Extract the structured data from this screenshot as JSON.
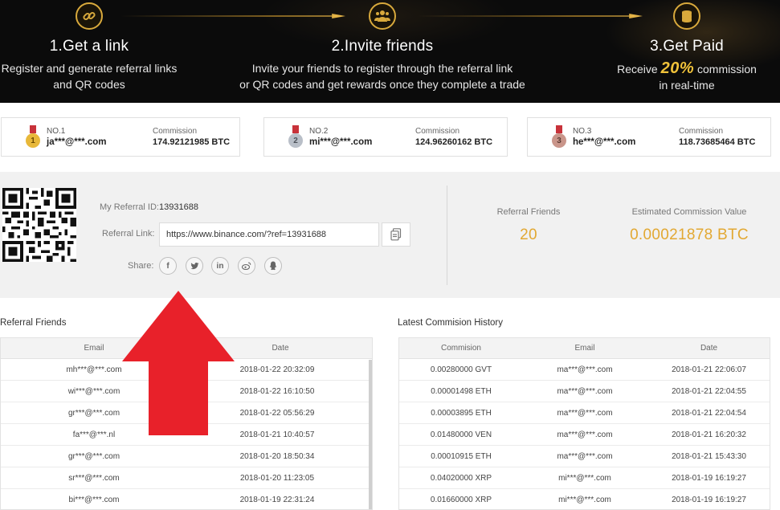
{
  "banner": {
    "steps": [
      {
        "title": "1.Get a link",
        "desc_line1": "Register and generate referral links",
        "desc_line2": "and QR codes"
      },
      {
        "title": "2.Invite friends",
        "desc_line1": "Invite your friends to register through the referral link",
        "desc_line2": "or QR codes and get rewards once they complete a trade"
      },
      {
        "title": "3.Get Paid",
        "desc_pre": "Receive",
        "desc_pct": "20%",
        "desc_post": "commission",
        "desc_line2": "in real-time"
      }
    ]
  },
  "top_referrers": [
    {
      "rank": "NO.1",
      "num": "1",
      "email": "ja***@***.com",
      "commission_label": "Commission",
      "commission": "174.92121985 BTC",
      "medal_color": "#e8b83a"
    },
    {
      "rank": "NO.2",
      "num": "2",
      "email": "mi***@***.com",
      "commission_label": "Commission",
      "commission": "124.96260162 BTC",
      "medal_color": "#b9bfc8"
    },
    {
      "rank": "NO.3",
      "num": "3",
      "email": "he***@***.com",
      "commission_label": "Commission",
      "commission": "118.73685464 BTC",
      "medal_color": "#c9958a"
    }
  ],
  "referral": {
    "id_label": "My Referral ID:",
    "id_value": "13931688",
    "link_label": "Referral Link:",
    "link_value": "https://www.binance.com/?ref=13931688",
    "share_label": "Share:",
    "share_icons": [
      "facebook-icon",
      "twitter-icon",
      "linkedin-icon",
      "weibo-icon",
      "qq-icon"
    ]
  },
  "stats": {
    "friends_label": "Referral Friends",
    "friends_value": "20",
    "commission_label": "Estimated Commission Value",
    "commission_value": "0.00021878 BTC"
  },
  "friends_table": {
    "title": "Referral Friends",
    "columns": [
      "Email",
      "Date"
    ],
    "rows": [
      [
        "mh***@***.com",
        "2018-01-22 20:32:09"
      ],
      [
        "wi***@***.com",
        "2018-01-22 16:10:50"
      ],
      [
        "gr***@***.com",
        "2018-01-22 05:56:29"
      ],
      [
        "fa***@***.nl",
        "2018-01-21 10:40:57"
      ],
      [
        "gr***@***.com",
        "2018-01-20 18:50:34"
      ],
      [
        "sr***@***.com",
        "2018-01-20 11:23:05"
      ],
      [
        "bi***@***.com",
        "2018-01-19 22:31:24"
      ]
    ]
  },
  "commission_table": {
    "title": "Latest Commision History",
    "columns": [
      "Commision",
      "Email",
      "Date"
    ],
    "rows": [
      [
        "0.00280000 GVT",
        "ma***@***.com",
        "2018-01-21 22:06:07"
      ],
      [
        "0.00001498 ETH",
        "ma***@***.com",
        "2018-01-21 22:04:55"
      ],
      [
        "0.00003895 ETH",
        "ma***@***.com",
        "2018-01-21 22:04:54"
      ],
      [
        "0.01480000 VEN",
        "ma***@***.com",
        "2018-01-21 16:20:32"
      ],
      [
        "0.00010915 ETH",
        "ma***@***.com",
        "2018-01-21 15:43:30"
      ],
      [
        "0.04020000 XRP",
        "mi***@***.com",
        "2018-01-19 16:19:27"
      ],
      [
        "0.01660000 XRP",
        "mi***@***.com",
        "2018-01-19 16:19:27"
      ]
    ]
  },
  "colors": {
    "accent": "#e2a832",
    "arrow": "#e8212a",
    "banner_bg": "#0b0b0b"
  }
}
